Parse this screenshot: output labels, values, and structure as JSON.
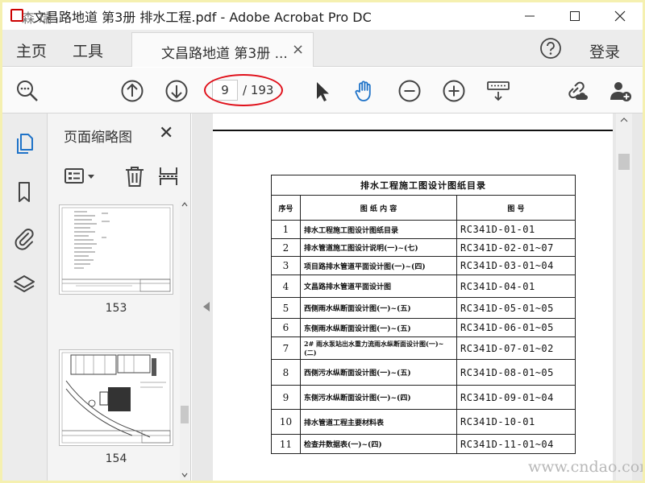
{
  "window": {
    "title": "文昌路地道 第3册 排水工程.pdf - Adobe Acrobat Pro DC",
    "icon_watermark": "森 瑞"
  },
  "menubar": {
    "home": "主页",
    "tools": "工具",
    "doc_tab": "文昌路地道 第3册 ...",
    "doc_tab_close": "×",
    "login": "登录"
  },
  "toolbar": {
    "current_page": "9",
    "total_pages": "/ 193"
  },
  "panel": {
    "title": "页面缩略图",
    "close": "✕",
    "thumbnails": [
      {
        "label": "153"
      },
      {
        "label": "154"
      }
    ]
  },
  "document": {
    "table_title": "排水工程施工图设计图纸目录",
    "headers": [
      "序号",
      "图 纸 内 容",
      "图 号"
    ],
    "rows": [
      {
        "no": "1",
        "name": "排水工程施工图设计图纸目录",
        "code": "RC341D-01-01"
      },
      {
        "no": "2",
        "name": "排水管道施工图设计说明(一)~(七)",
        "code": "RC341D-02-01~07"
      },
      {
        "no": "3",
        "name": "项目路排水管道平面设计图(一)~(四)",
        "code": "RC341D-03-01~04"
      },
      {
        "no": "4",
        "name": "文昌路排水管道平面设计图",
        "code": "RC341D-04-01"
      },
      {
        "no": "5",
        "name": "西侧雨水纵断面设计图(一)~(五)",
        "code": "RC341D-05-01~05"
      },
      {
        "no": "6",
        "name": "东侧雨水纵断面设计图(一)~(五)",
        "code": "RC341D-06-01~05"
      },
      {
        "no": "7",
        "name": "2# 雨水泵站出水重力流雨水纵断面设计图(一)~(二)",
        "code": "RC341D-07-01~02"
      },
      {
        "no": "8",
        "name": "西侧污水纵断面设计图(一)~(五)",
        "code": "RC341D-08-01~05"
      },
      {
        "no": "9",
        "name": "东侧污水纵断面设计图(一)~(四)",
        "code": "RC341D-09-01~04"
      },
      {
        "no": "10",
        "name": "排水管道工程主要材料表",
        "code": "RC341D-10-01"
      },
      {
        "no": "11",
        "name": "检查井数据表(一)~(四)",
        "code": "RC341D-11-01~04"
      }
    ]
  },
  "watermark": "www.cndao.com",
  "colors": {
    "accent_blue": "#1f73c8",
    "highlight_red": "#e0101a",
    "outer_border": "#f5f0b0"
  },
  "icons": {
    "zoom": "magnifier-icon",
    "prev": "arrow-up-circle-icon",
    "next": "arrow-down-circle-icon",
    "select": "cursor-arrow-icon",
    "hand": "hand-icon",
    "zoom_out": "minus-circle-icon",
    "zoom_in": "plus-circle-icon",
    "keyboard": "keyboard-icon",
    "share_link": "link-cloud-icon",
    "add_user": "add-user-icon"
  }
}
